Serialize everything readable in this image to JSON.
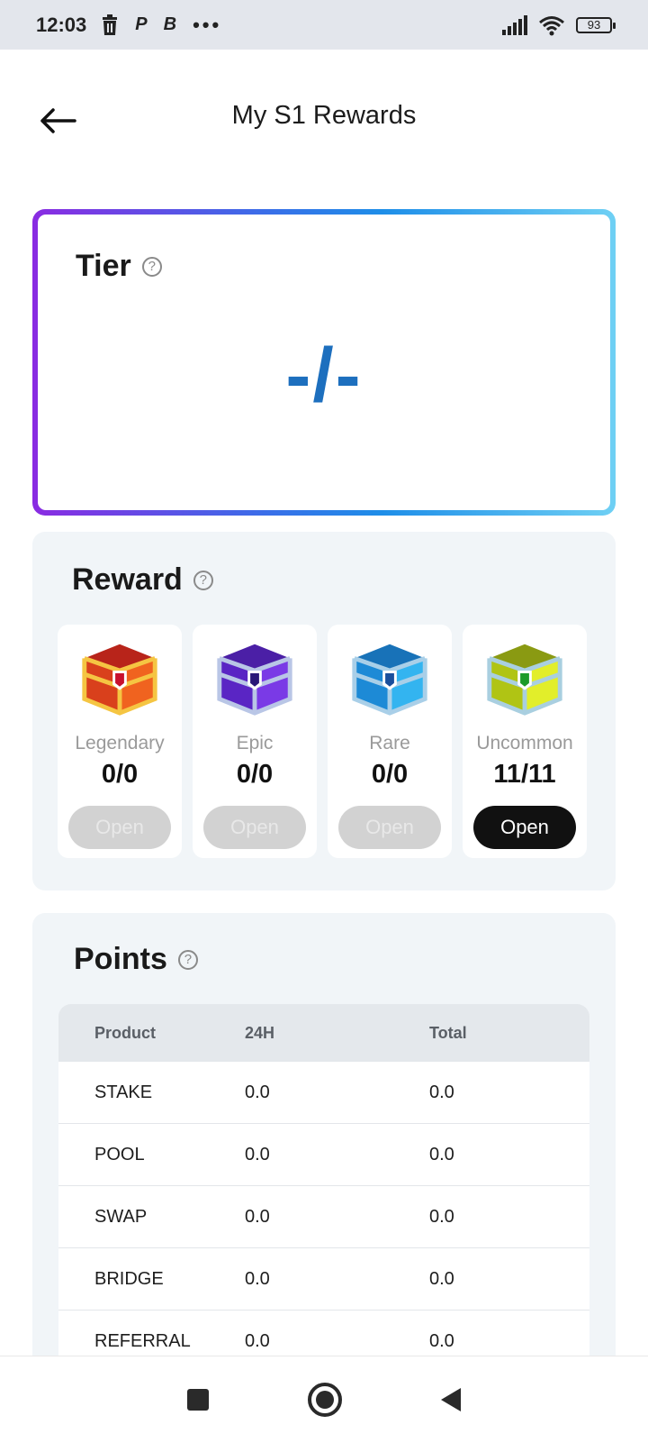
{
  "status_bar": {
    "time": "12:03",
    "icons": [
      "trash-icon",
      "p-app-icon",
      "b-app-icon",
      "more-dots-icon",
      "signal-icon",
      "wifi-icon",
      "battery-icon"
    ],
    "p_glyph": "P",
    "b_glyph": "B",
    "dots": "•••",
    "battery": "93"
  },
  "header": {
    "back_icon": "arrow-left-icon",
    "title": "My S1 Rewards"
  },
  "tier": {
    "title": "Tier",
    "help": "?",
    "value": "-/-",
    "gradient": [
      "#8a2be2",
      "#1e8ee8",
      "#6fd0f4"
    ]
  },
  "reward": {
    "title": "Reward",
    "help": "?",
    "chests": [
      {
        "name": "Legendary",
        "count": "0/0",
        "button": "Open",
        "enabled": false,
        "color": "#e8531a"
      },
      {
        "name": "Epic",
        "count": "0/0",
        "button": "Open",
        "enabled": false,
        "color": "#6a2bd8"
      },
      {
        "name": "Rare",
        "count": "0/0",
        "button": "Open",
        "enabled": false,
        "color": "#1e9de6"
      },
      {
        "name": "Uncommon",
        "count": "11/11",
        "button": "Open",
        "enabled": true,
        "color": "#c8d81e"
      }
    ]
  },
  "points": {
    "title": "Points",
    "help": "?",
    "columns": [
      "Product",
      "24H",
      "Total"
    ],
    "rows": [
      [
        "STAKE",
        "0.0",
        "0.0"
      ],
      [
        "POOL",
        "0.0",
        "0.0"
      ],
      [
        "SWAP",
        "0.0",
        "0.0"
      ],
      [
        "BRIDGE",
        "0.0",
        "0.0"
      ],
      [
        "REFERRAL",
        "0.0",
        "0.0"
      ]
    ]
  },
  "nav": {
    "icons": [
      "recents-square-icon",
      "home-circle-icon",
      "back-triangle-icon"
    ]
  },
  "colors": {
    "accent_blue": "#1d6fbe",
    "button_dark": "#111111",
    "button_disabled": "#d2d2d2",
    "card_bg": "#f1f5f8"
  }
}
